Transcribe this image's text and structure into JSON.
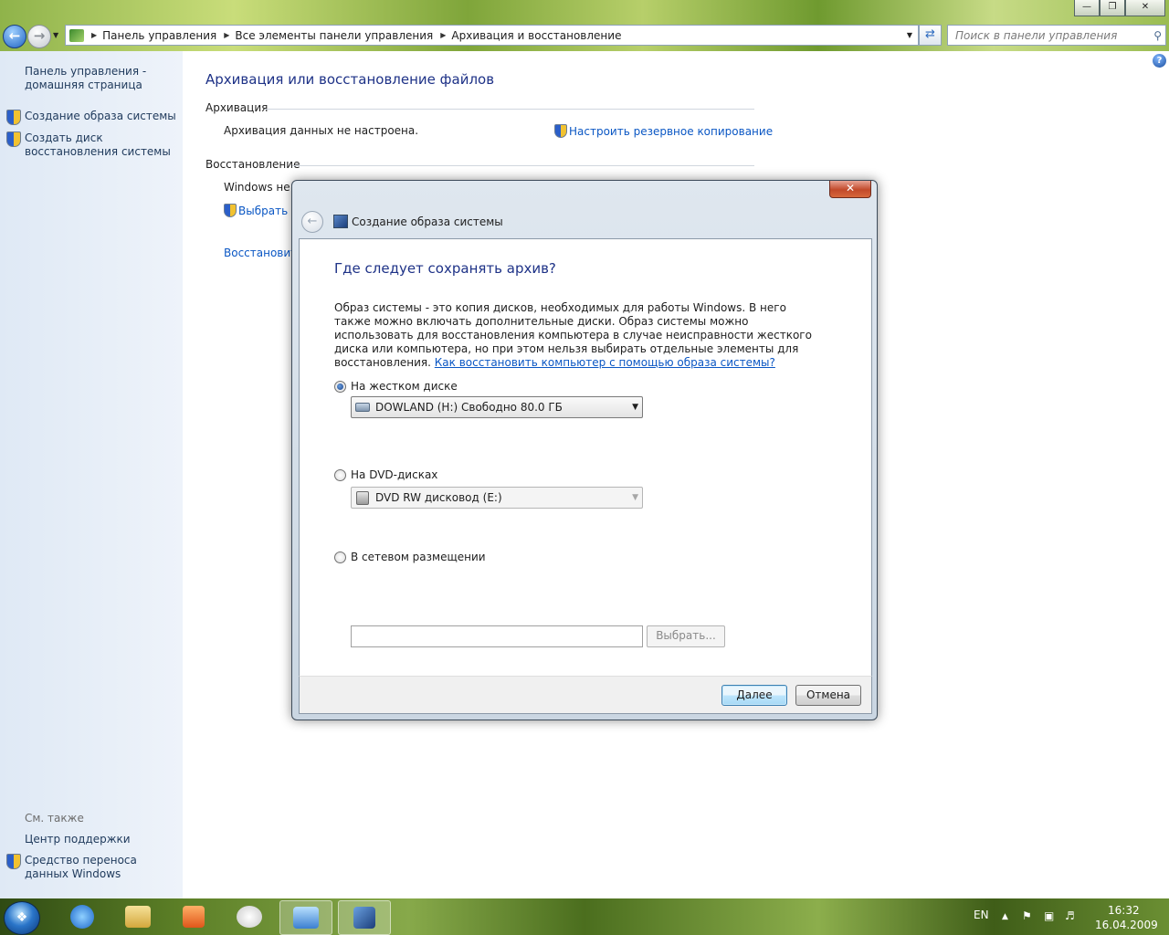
{
  "window": {
    "minimize_glyph": "—",
    "maximize_glyph": "❐",
    "close_glyph": "✕"
  },
  "address": {
    "crumbs": [
      "Панель управления",
      "Все элементы панели управления",
      "Архивация и восстановление"
    ],
    "search_placeholder": "Поиск в панели управления"
  },
  "sidebar": {
    "home_link": "Панель управления - домашняя страница",
    "tasks": [
      "Создание образа системы",
      "Создать диск восстановления системы"
    ],
    "see_also_label": "См. также",
    "see_also": [
      "Центр поддержки",
      "Средство переноса данных Windows"
    ]
  },
  "main": {
    "title": "Архивация или восстановление файлов",
    "backup_section": "Архивация",
    "backup_status": "Архивация данных не настроена.",
    "setup_backup_link": "Настроить резервное копирование",
    "restore_section": "Восстановление",
    "restore_text": "Windows не у",
    "restore_link1": "Выбрать д",
    "restore_link2": "Восстановить"
  },
  "dialog": {
    "close_glyph": "✕",
    "title": "Создание образа системы",
    "heading": "Где следует сохранять архив?",
    "description": "Образ системы - это копия дисков, необходимых для работы Windows. В него также можно включать дополнительные диски. Образ системы можно использовать для восстановления компьютера в случае неисправности жесткого диска или компьютера, но при этом нельзя выбирать отдельные элементы для восстановления.",
    "help_link": "Как восстановить компьютер с помощью образа системы?",
    "options": {
      "hdd_label": "На жестком диске",
      "hdd_value": "DOWLAND (H:)  Свободно 80.0 ГБ",
      "dvd_label": "На DVD-дисках",
      "dvd_value": "DVD RW дисковод (E:)",
      "network_label": "В сетевом размещении",
      "network_value": "",
      "browse_button": "Выбрать..."
    },
    "selected_option": "hdd",
    "next_button": "Далее",
    "cancel_button": "Отмена"
  },
  "taskbar": {
    "items": [
      "start",
      "internet-explorer",
      "explorer",
      "media-player",
      "paint",
      "control-panel",
      "system-image"
    ],
    "language": "EN",
    "time": "16:32",
    "date": "16.04.2009"
  },
  "colors": {
    "link": "#0b57c4",
    "heading": "#1e3287",
    "sidebar_bg": "#dfe9f5"
  }
}
